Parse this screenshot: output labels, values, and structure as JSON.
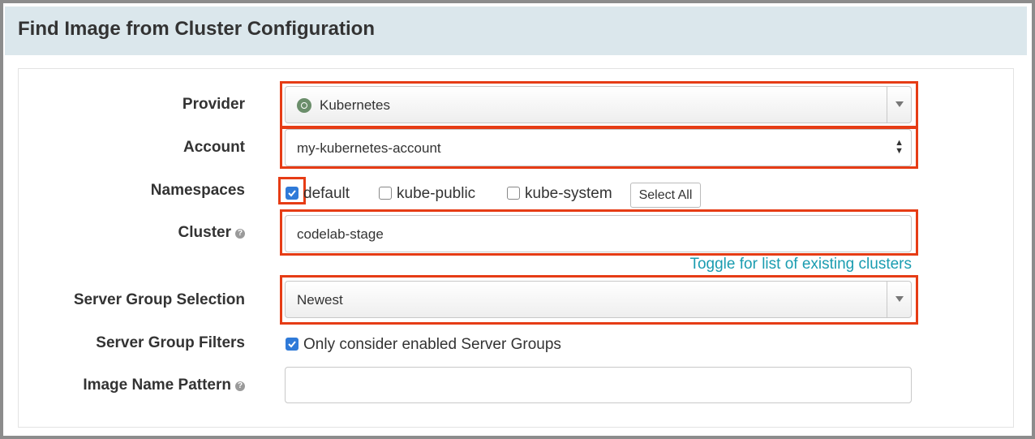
{
  "header": {
    "title": "Find Image from Cluster Configuration"
  },
  "form": {
    "provider": {
      "label": "Provider",
      "value": "Kubernetes",
      "icon": "kubernetes-icon"
    },
    "account": {
      "label": "Account",
      "value": "my-kubernetes-account"
    },
    "namespaces": {
      "label": "Namespaces",
      "options": [
        {
          "label": "default",
          "checked": true
        },
        {
          "label": "kube-public",
          "checked": false
        },
        {
          "label": "kube-system",
          "checked": false
        }
      ],
      "select_all_label": "Select All"
    },
    "cluster": {
      "label": "Cluster",
      "value": "codelab-stage",
      "toggle_link": "Toggle for list of existing clusters"
    },
    "server_group_selection": {
      "label": "Server Group Selection",
      "value": "Newest"
    },
    "server_group_filters": {
      "label": "Server Group Filters",
      "option_label": "Only consider enabled Server Groups",
      "checked": true
    },
    "image_name_pattern": {
      "label": "Image Name Pattern",
      "value": ""
    }
  },
  "colors": {
    "highlight": "#e63c15",
    "accent": "#2f7ad8",
    "link": "#1a9cb0",
    "header_bg": "#dbe7ec"
  }
}
